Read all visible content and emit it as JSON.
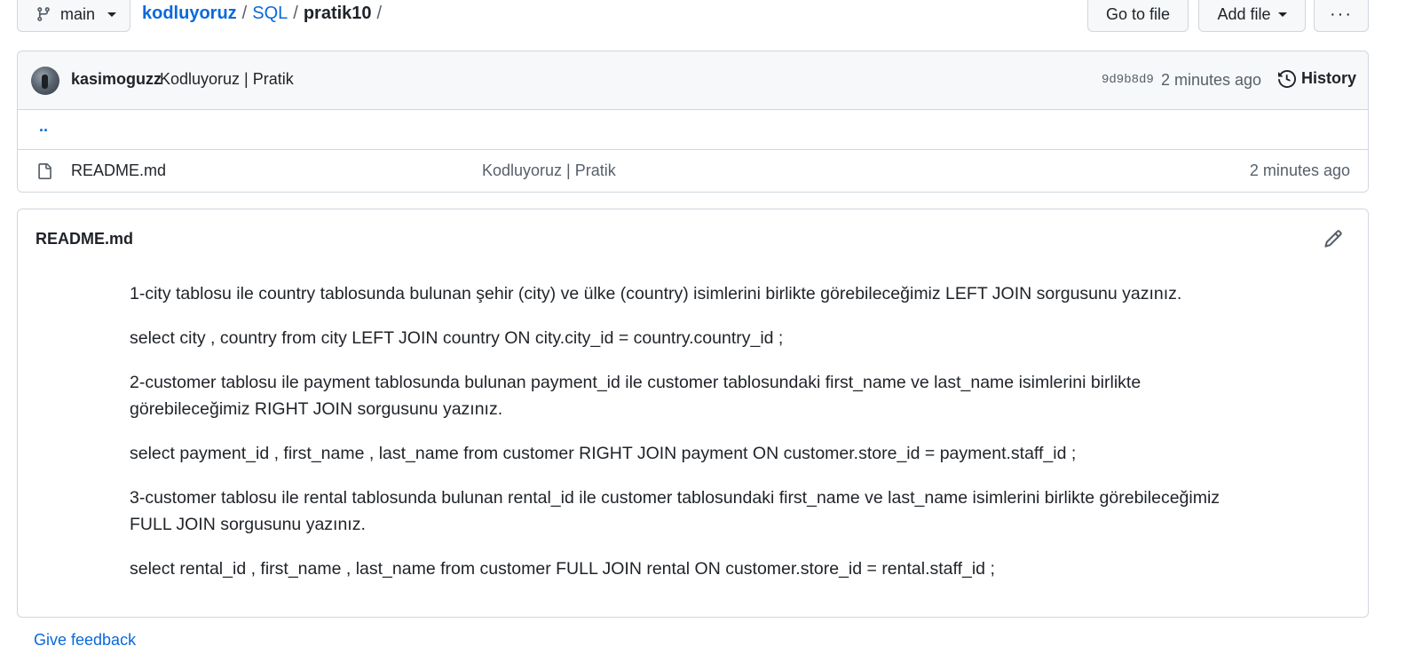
{
  "topbar": {
    "branch": "main",
    "breadcrumb": {
      "owner": "kodluyoruz",
      "folder": "SQL",
      "current": "pratik10",
      "separator": "/"
    },
    "go_to_file": "Go to file",
    "add_file": "Add file",
    "more": "···"
  },
  "commit": {
    "author": "kasimoguzz",
    "message": "Kodluyoruz | Pratik",
    "sha": "9d9b8d9",
    "time": "2 minutes ago",
    "history_label": "History"
  },
  "files": {
    "parent_dir": "..",
    "items": [
      {
        "name": "README.md",
        "commit_message": "Kodluyoruz | Pratik",
        "time": "2 minutes ago"
      }
    ]
  },
  "readme": {
    "title": "README.md",
    "paragraphs": [
      "1-city tablosu ile country tablosunda bulunan şehir (city) ve ülke (country) isimlerini birlikte görebileceğimiz LEFT JOIN sorgusunu yazınız.",
      "select city , country from city LEFT JOIN country ON city.city_id = country.country_id ;",
      "2-customer tablosu ile payment tablosunda bulunan payment_id ile customer tablosundaki first_name ve last_name isimlerini birlikte görebileceğimiz RIGHT JOIN sorgusunu yazınız.",
      "select payment_id , first_name , last_name from customer RIGHT JOIN payment ON customer.store_id = payment.staff_id ;",
      "3-customer tablosu ile rental tablosunda bulunan rental_id ile customer tablosundaki first_name ve last_name isimlerini birlikte görebileceğimiz FULL JOIN sorgusunu yazınız.",
      "select rental_id , first_name , last_name from customer FULL JOIN rental ON customer.store_id = rental.staff_id ;"
    ]
  },
  "feedback": "Give feedback",
  "colors": {
    "link": "#0969da",
    "border": "#d0d7de",
    "muted": "#57606a",
    "header_bg": "#f6f8fa"
  }
}
